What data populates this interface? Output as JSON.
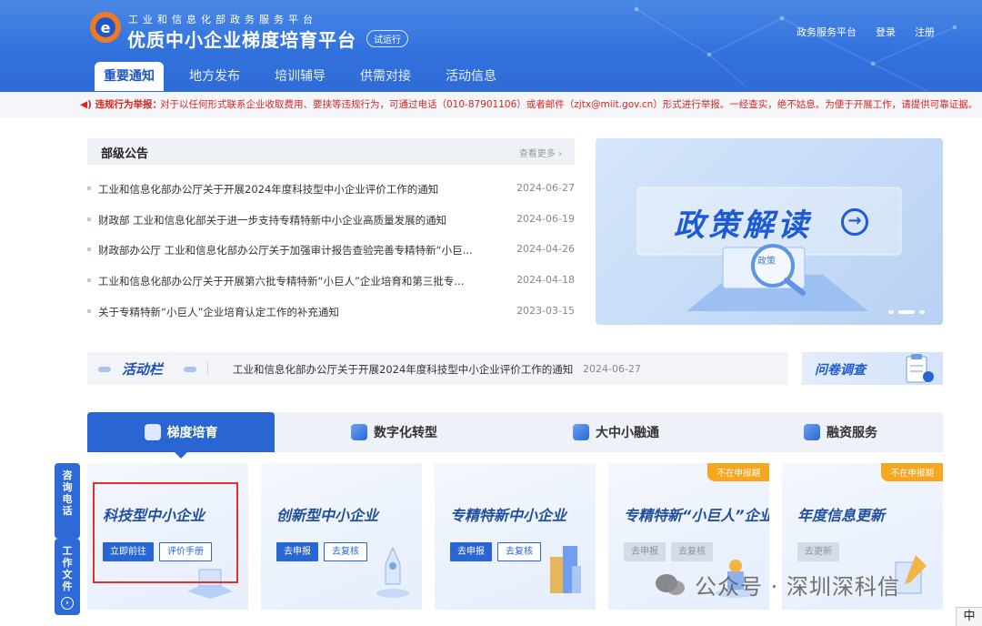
{
  "header": {
    "subtitle": "工业和信息化部政务服务平台",
    "title": "优质中小企业梯度培育平台",
    "badge": "试运行",
    "links": [
      "政务服务平台",
      "登录",
      "注册"
    ]
  },
  "nav": [
    "重要通知",
    "地方发布",
    "培训辅导",
    "供需对接",
    "活动信息"
  ],
  "notice": {
    "label": "违规行为举报：",
    "text": "对于以任何形式联系企业收取费用、要挟等违规行为，可通过电话（010-87901106）或者邮件（zjtx@miit.gov.cn）形式进行举报。一经查实，绝不姑息。为便于开展工作，请提供可靠证据。"
  },
  "announcements": {
    "title": "部级公告",
    "more": "查看更多",
    "items": [
      {
        "title": "工业和信息化部办公厅关于开展2024年度科技型中小企业评价工作的通知",
        "date": "2024-06-27"
      },
      {
        "title": "财政部 工业和信息化部关于进一步支持专精特新中小企业高质量发展的通知",
        "date": "2024-06-19"
      },
      {
        "title": "财政部办公厅 工业和信息化部办公厅关于加强审计报告查验完善专精特新“小巨...",
        "date": "2024-04-26"
      },
      {
        "title": "工业和信息化部办公厅关于开展第六批专精特新“小巨人”企业培育和第三批专...",
        "date": "2024-04-18"
      },
      {
        "title": "关于专精特新“小巨人”企业培育认定工作的补充通知",
        "date": "2023-03-15"
      }
    ]
  },
  "banner": {
    "title": "政策解读",
    "tag": "政策"
  },
  "activity": {
    "title": "活动栏",
    "text": "工业和信息化部办公厅关于开展2024年度科技型中小企业评价工作的通知",
    "date": "2024-06-27"
  },
  "survey": {
    "title": "问卷调查"
  },
  "tabs": [
    "梯度培育",
    "数字化转型",
    "大中小融通",
    "融资服务"
  ],
  "cards": [
    {
      "title": "科技型中小企业",
      "buttons": [
        "立即前往",
        "评价手册"
      ]
    },
    {
      "title": "创新型中小企业",
      "buttons": [
        "去申报",
        "去复核"
      ]
    },
    {
      "title": "专精特新中小企业",
      "buttons": [
        "去申报",
        "去复核"
      ]
    },
    {
      "title": "专精特新“小巨人”企业",
      "buttons": [
        "去申报",
        "去复核"
      ],
      "ribbon": "不在申报期"
    },
    {
      "title": "年度信息更新",
      "buttons": [
        "去更新"
      ],
      "ribbon": "不在申报期"
    }
  ],
  "side": {
    "consult": "咨询电话",
    "files": "工作文件"
  },
  "watermark": "公众号 · 深圳深科信",
  "ime": "中",
  "colors": {
    "primary": "#2966d4",
    "header": "#3272dd",
    "alert": "#d9251c",
    "ribbon": "#f7a61f",
    "highlight_box": "#e3302f"
  }
}
